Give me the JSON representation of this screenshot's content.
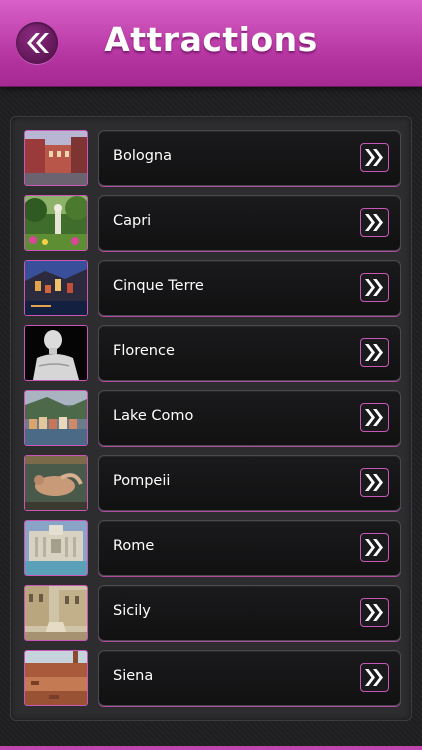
{
  "header": {
    "title": "Attractions",
    "back_icon": "double-chevron-left-icon",
    "accent_color": "#c244b0"
  },
  "attractions": [
    {
      "name": "Bologna",
      "thumb": "city-square-photo"
    },
    {
      "name": "Capri",
      "thumb": "garden-statue-photo"
    },
    {
      "name": "Cinque Terre",
      "thumb": "coastal-village-night-photo"
    },
    {
      "name": "Florence",
      "thumb": "david-statue-photo"
    },
    {
      "name": "Lake Como",
      "thumb": "lakeside-town-photo"
    },
    {
      "name": "Pompeii",
      "thumb": "fresco-photo"
    },
    {
      "name": "Rome",
      "thumb": "trevi-fountain-photo"
    },
    {
      "name": "Sicily",
      "thumb": "baroque-church-photo"
    },
    {
      "name": "Siena",
      "thumb": "rooftops-photo"
    }
  ],
  "row_action_icon": "double-chevron-right-icon"
}
